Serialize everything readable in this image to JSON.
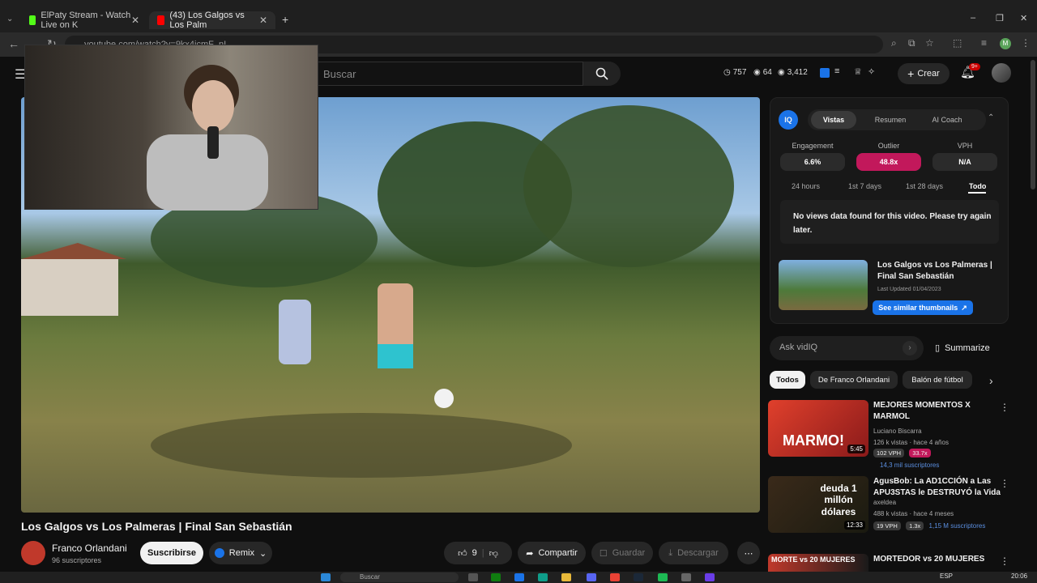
{
  "browser": {
    "tabs": [
      {
        "label": "ElPaty Stream - Watch Live on K",
        "color": "#53fc18"
      },
      {
        "label": "(43) Los Galgos vs Los Palm",
        "color": "#ff0000"
      }
    ],
    "new_tab": "+",
    "url": "youtube.com/watch?v=9kx4icmF_nI",
    "window_controls": [
      "–",
      "❐",
      "✕"
    ]
  },
  "youtube": {
    "search_placeholder": "Buscar",
    "stats": [
      {
        "icon": "clock-icon",
        "value": "757"
      },
      {
        "icon": "eye-icon",
        "value": "64"
      },
      {
        "icon": "eye-icon",
        "value": "3,412"
      }
    ],
    "create_label": "Crear",
    "notif_badge": "9+",
    "video_title": "Los Galgos vs Los Palmeras | Final San Sebastián",
    "channel_name": "Franco Orlandani",
    "subscribers": "96 suscriptores",
    "subscribe_label": "Suscribirse",
    "remix_label": "Remix",
    "likes": "9",
    "share_label": "Compartir",
    "save_label": "Guardar",
    "download_label": "Descargar"
  },
  "vidiq": {
    "logo": "IQ",
    "tabs": [
      "Vistas",
      "Resumen",
      "AI Coach"
    ],
    "metrics": [
      {
        "label": "Engagement",
        "value": "6.6%"
      },
      {
        "label": "Outlier",
        "value": "48.8x"
      },
      {
        "label": "VPH",
        "value": "N/A"
      }
    ],
    "ranges": [
      "24 hours",
      "1st 7 days",
      "1st 28 days",
      "Todo"
    ],
    "no_data": "No views data found for this video. Please try again later.",
    "thumb_title": "Los Galgos vs Los Palmeras | Final San Sebastián",
    "last_updated": "Last Updated 01/04/2023",
    "similar_label": "See similar thumbnails",
    "ask_placeholder": "Ask vidIQ",
    "summarize_label": "Summarize"
  },
  "chips": [
    "Todos",
    "De Franco Orlandani",
    "Balón de fútbol"
  ],
  "recommendations": [
    {
      "title": "MEJORES MOMENTOS X MARMOL",
      "channel": "Luciano Biscarra",
      "views": "126 k vistas · hace 4 años",
      "vph": "102 VPH",
      "outlier": "33.7x",
      "subs": "14,3 mil suscriptores",
      "duration": "5:45",
      "thumb_text": "MARMO!"
    },
    {
      "title": "AgusBob: La AD1CCIÓN a Las APU3STAS le DESTRUYÓ la Vida",
      "channel": "axeldea",
      "views": "488 k vistas · hace 4 meses",
      "vph": "19 VPH",
      "outlier": "1.3x",
      "subs": "1,15 M suscriptores",
      "duration": "12:33",
      "thumb_text": "deuda 1 millón dólares"
    },
    {
      "title": "MORTEDOR vs 20 MUJERES",
      "channel": "",
      "views": "",
      "vph": "",
      "outlier": "",
      "subs": "",
      "duration": "",
      "thumb_text": "MORTE vs 20 MUJERES"
    }
  ],
  "taskbar": {
    "search_placeholder": "Buscar",
    "lang": "ESP",
    "time": "20:06"
  },
  "colors": {
    "outlier": "#c2185b",
    "similar_button": "#1a73e8",
    "vidiq_blue": "#1a73e8"
  }
}
